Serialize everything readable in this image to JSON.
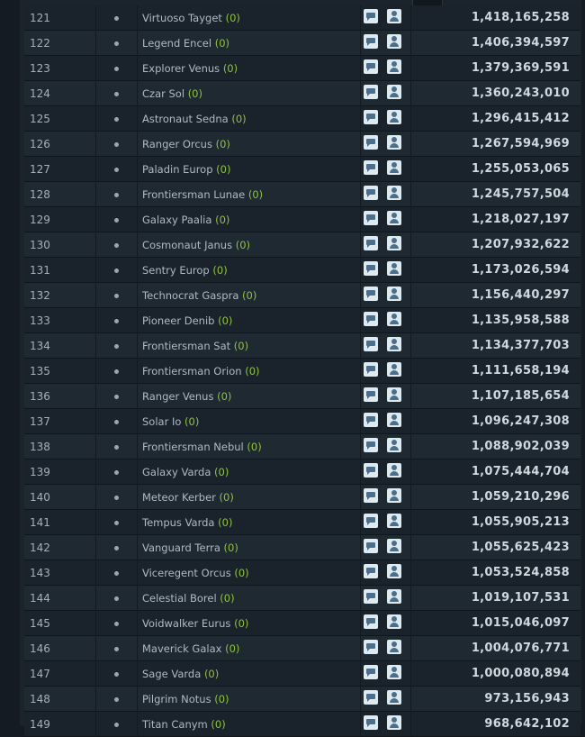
{
  "leaderboard": {
    "rows": [
      {
        "rank": "121",
        "name": "Virtuoso Tayget",
        "count": "(0)",
        "score": "1,418,165,258"
      },
      {
        "rank": "122",
        "name": "Legend Encel",
        "count": "(0)",
        "score": "1,406,394,597"
      },
      {
        "rank": "123",
        "name": "Explorer Venus",
        "count": "(0)",
        "score": "1,379,369,591"
      },
      {
        "rank": "124",
        "name": "Czar Sol",
        "count": "(0)",
        "score": "1,360,243,010"
      },
      {
        "rank": "125",
        "name": "Astronaut Sedna",
        "count": "(0)",
        "score": "1,296,415,412"
      },
      {
        "rank": "126",
        "name": "Ranger Orcus",
        "count": "(0)",
        "score": "1,267,594,969"
      },
      {
        "rank": "127",
        "name": "Paladin Europ",
        "count": "(0)",
        "score": "1,255,053,065"
      },
      {
        "rank": "128",
        "name": "Frontiersman Lunae",
        "count": "(0)",
        "score": "1,245,757,504"
      },
      {
        "rank": "129",
        "name": "Galaxy Paalia",
        "count": "(0)",
        "score": "1,218,027,197"
      },
      {
        "rank": "130",
        "name": "Cosmonaut Janus",
        "count": "(0)",
        "score": "1,207,932,622"
      },
      {
        "rank": "131",
        "name": "Sentry Europ",
        "count": "(0)",
        "score": "1,173,026,594"
      },
      {
        "rank": "132",
        "name": "Technocrat Gaspra",
        "count": "(0)",
        "score": "1,156,440,297"
      },
      {
        "rank": "133",
        "name": "Pioneer Denib",
        "count": "(0)",
        "score": "1,135,958,588"
      },
      {
        "rank": "134",
        "name": "Frontiersman Sat",
        "count": "(0)",
        "score": "1,134,377,703"
      },
      {
        "rank": "135",
        "name": "Frontiersman Orion",
        "count": "(0)",
        "score": "1,111,658,194"
      },
      {
        "rank": "136",
        "name": "Ranger Venus",
        "count": "(0)",
        "score": "1,107,185,654"
      },
      {
        "rank": "137",
        "name": "Solar Io",
        "count": "(0)",
        "score": "1,096,247,308"
      },
      {
        "rank": "138",
        "name": "Frontiersman Nebul",
        "count": "(0)",
        "score": "1,088,902,039"
      },
      {
        "rank": "139",
        "name": "Galaxy Varda",
        "count": "(0)",
        "score": "1,075,444,704"
      },
      {
        "rank": "140",
        "name": "Meteor Kerber",
        "count": "(0)",
        "score": "1,059,210,296"
      },
      {
        "rank": "141",
        "name": "Tempus Varda",
        "count": "(0)",
        "score": "1,055,905,213"
      },
      {
        "rank": "142",
        "name": "Vanguard Terra",
        "count": "(0)",
        "score": "1,055,625,423"
      },
      {
        "rank": "143",
        "name": "Viceregent Orcus",
        "count": "(0)",
        "score": "1,053,524,858"
      },
      {
        "rank": "144",
        "name": "Celestial Borel",
        "count": "(0)",
        "score": "1,019,107,531"
      },
      {
        "rank": "145",
        "name": "Voidwalker Eurus",
        "count": "(0)",
        "score": "1,015,046,097"
      },
      {
        "rank": "146",
        "name": "Maverick Galax",
        "count": "(0)",
        "score": "1,004,076,771"
      },
      {
        "rank": "147",
        "name": "Sage Varda",
        "count": "(0)",
        "score": "1,000,080,894"
      },
      {
        "rank": "148",
        "name": "Pilgrim Notus",
        "count": "(0)",
        "score": "973,156,943"
      },
      {
        "rank": "149",
        "name": "Titan Canym",
        "count": "(0)",
        "score": "968,642,102"
      }
    ],
    "icons": {
      "message": "message-icon",
      "profile": "profile-icon"
    },
    "colors": {
      "count": "#8ec244",
      "score": "#cfd8df",
      "background": "#1b242c"
    }
  }
}
